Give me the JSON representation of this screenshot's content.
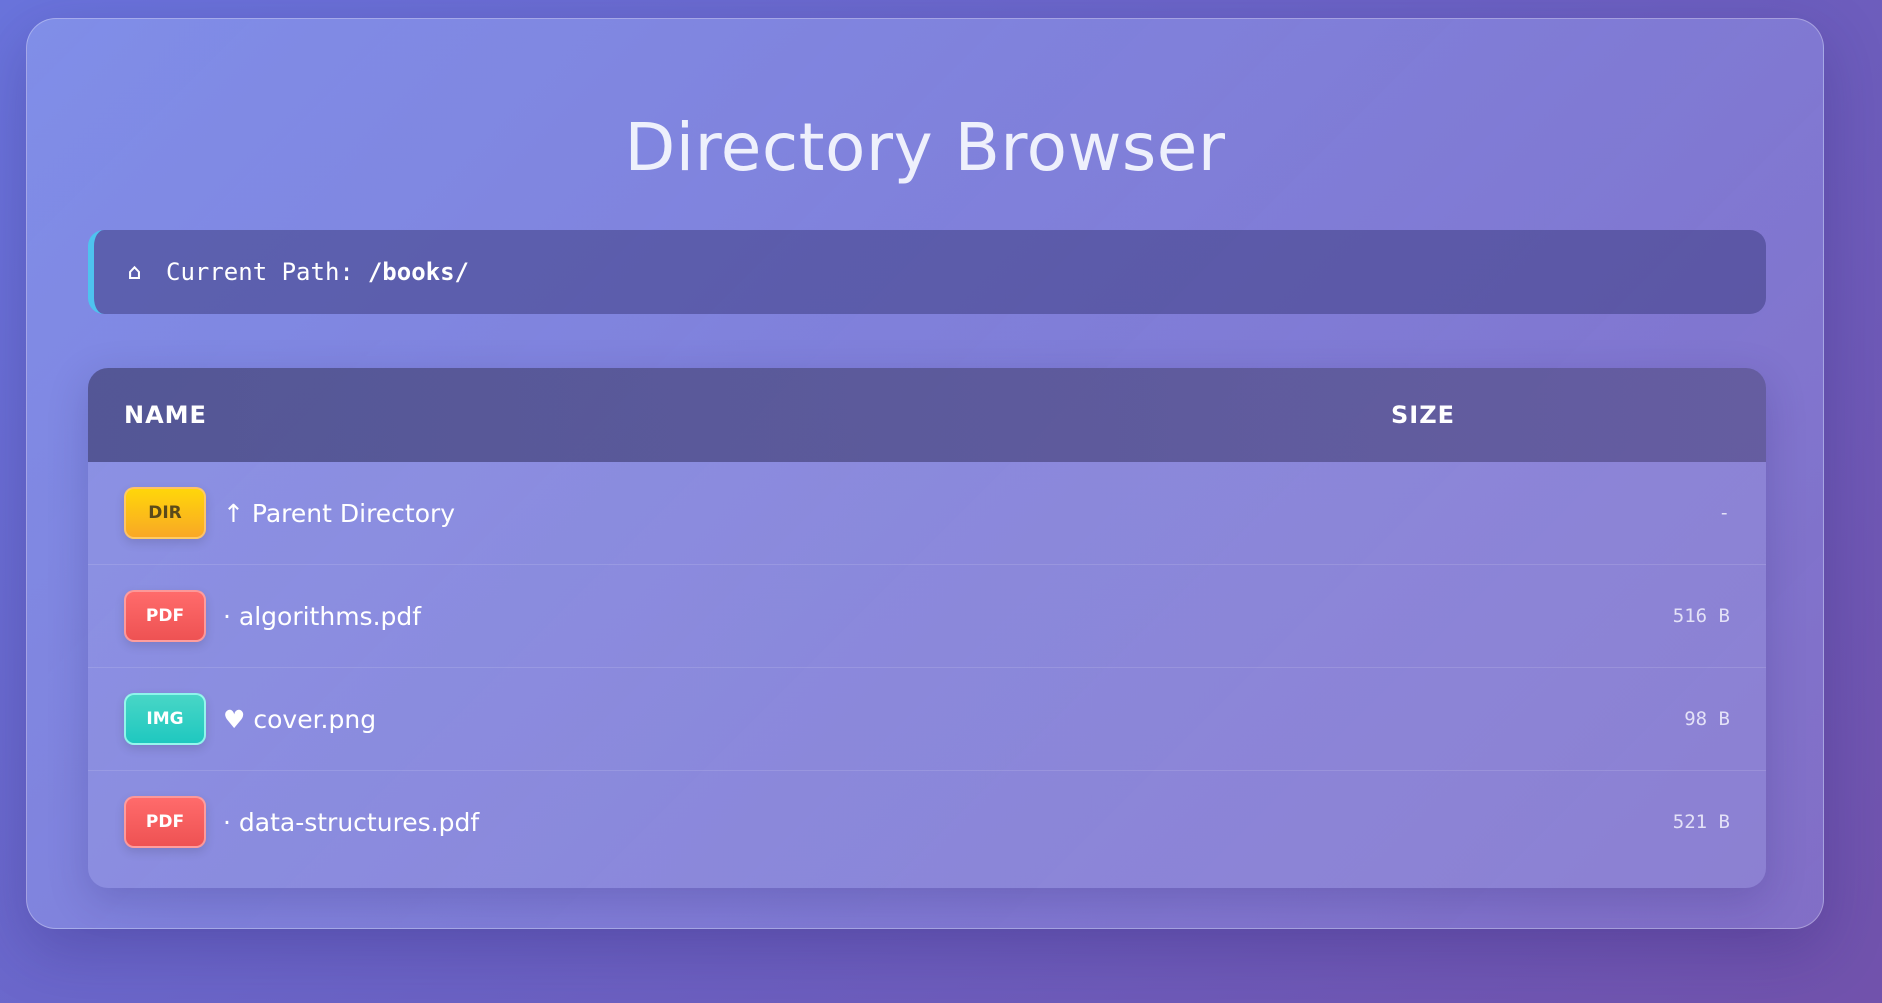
{
  "title": "Directory Browser",
  "path_bar": {
    "icon": "home-icon",
    "icon_glyph": "⌂",
    "label": "Current Path:",
    "value": "/books/"
  },
  "table": {
    "headers": {
      "name": "NAME",
      "size": "SIZE"
    },
    "rows": [
      {
        "badge": "DIR",
        "type": "dir",
        "name": "↑ Parent Directory",
        "size": "-"
      },
      {
        "badge": "PDF",
        "type": "pdf",
        "name": "· algorithms.pdf",
        "size": "516 B"
      },
      {
        "badge": "IMG",
        "type": "img",
        "name": "♥ cover.png",
        "size": "98 B"
      },
      {
        "badge": "PDF",
        "type": "pdf",
        "name": "· data-structures.pdf",
        "size": "521 B"
      }
    ]
  },
  "colors": {
    "path_accent": "#4ec3ef",
    "dir_badge": "#ffd60a",
    "pdf_badge": "#ff6b6b",
    "img_badge": "#2fd0c2"
  }
}
